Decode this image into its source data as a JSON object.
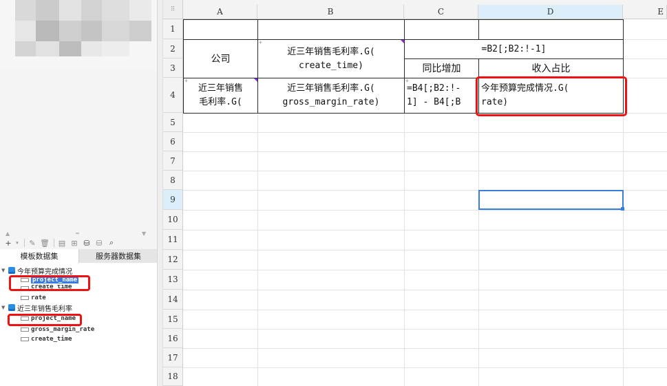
{
  "panel": {
    "tabs": [
      {
        "label": "模板数据集",
        "active": true
      },
      {
        "label": "服务器数据集",
        "active": false
      }
    ],
    "datasets": [
      {
        "name": "今年预算完成情况",
        "fields": [
          "project_name",
          "create_time",
          "rate"
        ]
      },
      {
        "name": "近三年销售毛利率",
        "fields": [
          "project_name",
          "gross_margin_rate",
          "create_time"
        ]
      }
    ],
    "toolbar_icons": [
      "add-dataset-icon",
      "dropdown-icon",
      "edit-icon",
      "delete-icon",
      "preview-icon",
      "stored-procedure-icon",
      "server-dataset-icon",
      "database-icon",
      "search-icon"
    ]
  },
  "sheet": {
    "columns": [
      "A",
      "B",
      "C",
      "D",
      "E"
    ],
    "rows": [
      "1",
      "2",
      "3",
      "4",
      "5",
      "6",
      "7",
      "8",
      "9",
      "10",
      "11",
      "12",
      "13",
      "14",
      "15",
      "16",
      "17",
      "18"
    ],
    "selected_cell": "D9",
    "cells": {
      "a23": "公司",
      "b23": "近三年销售毛利率.G(\ncreate_time)",
      "cd2": "=B2[;B2:!-1]",
      "c3": "同比增加",
      "d3": "收入占比",
      "a4": "近三年销售\n毛利率.G(",
      "b4": "近三年销售毛利率.G(\ngross_margin_rate)",
      "c4": "=B4[;B2:!-\n1] - B4[;B",
      "d4": "今年预算完成情况.G(\nrate)"
    }
  },
  "colors": {
    "highlight_red": "#ee1111",
    "selection_blue": "#3a7be0",
    "dataset_icon_blue": "#2b8de3"
  }
}
